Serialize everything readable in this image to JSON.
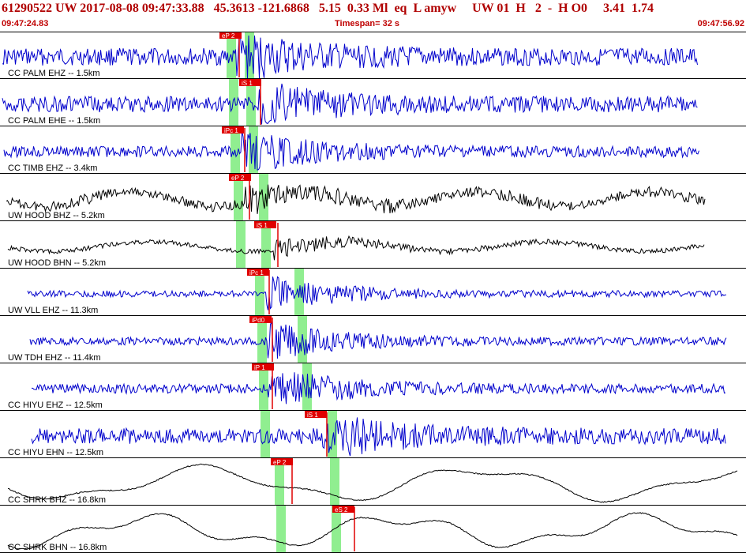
{
  "header": {
    "event_line": "61290522 UW 2017-08-08 09:47:33.88   45.3613 -121.6868   5.15  0.33 Ml  eq  L amyw     UW 01  H   2  -  H O0     3.41  1.74",
    "start_time": "09:47:24.83",
    "timespan": "Timespan=  32 s",
    "end_time": "09:47:56.92"
  },
  "colors": {
    "header_text": "#b00000",
    "trace_blue": "#0000cc",
    "trace_black": "#000000",
    "pick_red": "#e00000",
    "window_green": "#90ee90"
  },
  "traces": [
    {
      "label": "CC PALM EHZ -- 1.5km",
      "color": "#0000cc",
      "picks": [
        "eP 2"
      ]
    },
    {
      "label": "CC PALM EHE -- 1.5km",
      "color": "#0000cc",
      "picks": [
        "iS 1"
      ]
    },
    {
      "label": "CC TIMB EHZ -- 3.4km",
      "color": "#0000cc",
      "picks": [
        "iPc 1"
      ]
    },
    {
      "label": "UW HOOD BHZ -- 5.2km",
      "color": "#000000",
      "picks": [
        "eP 2"
      ]
    },
    {
      "label": "UW HOOD BHN -- 5.2km",
      "color": "#000000",
      "picks": [
        "iS 1"
      ]
    },
    {
      "label": "UW VLL EHZ -- 11.3km",
      "color": "#0000cc",
      "picks": [
        "iPc 1"
      ]
    },
    {
      "label": "UW TDH EHZ -- 11.4km",
      "color": "#0000cc",
      "picks": [
        "iPd0"
      ]
    },
    {
      "label": "CC HIYU EHZ -- 12.5km",
      "color": "#0000cc",
      "picks": [
        "iP 1"
      ]
    },
    {
      "label": "CC HIYU EHN -- 12.5km",
      "color": "#0000cc",
      "picks": [
        "iS 1"
      ]
    },
    {
      "label": "CC SHRK BHZ -- 16.8km",
      "color": "#000000",
      "picks": [
        "eP 2"
      ]
    },
    {
      "label": "CC SHRK BHN -- 16.8km",
      "color": "#000000",
      "picks": [
        "eS 2"
      ]
    }
  ]
}
